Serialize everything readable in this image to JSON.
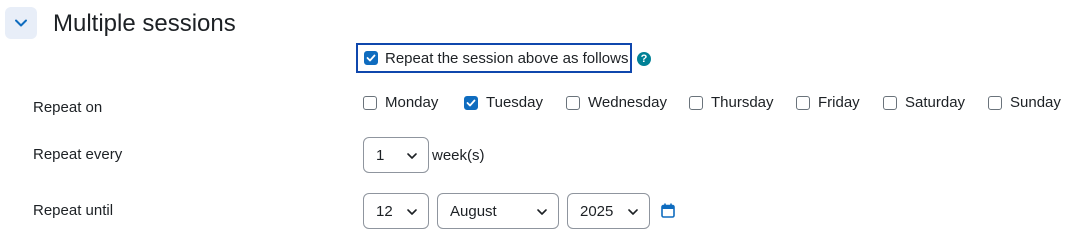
{
  "section": {
    "title": "Multiple sessions"
  },
  "repeat_master": {
    "label": "Repeat the session above as follows",
    "checked": true,
    "help": "?"
  },
  "repeat_on": {
    "label": "Repeat on",
    "days": [
      {
        "name": "Monday",
        "checked": false
      },
      {
        "name": "Tuesday",
        "checked": true
      },
      {
        "name": "Wednesday",
        "checked": false
      },
      {
        "name": "Thursday",
        "checked": false
      },
      {
        "name": "Friday",
        "checked": false
      },
      {
        "name": "Saturday",
        "checked": false
      },
      {
        "name": "Sunday",
        "checked": false
      }
    ]
  },
  "repeat_every": {
    "label": "Repeat every",
    "value": "1",
    "unit": "week(s)"
  },
  "repeat_until": {
    "label": "Repeat until",
    "day": "12",
    "month": "August",
    "year": "2025"
  },
  "colors": {
    "accent": "#0f6cbf",
    "focus_border": "#0f47ad",
    "help": "#008196"
  },
  "icons": {
    "collapse": "chevron-down-icon",
    "calendar": "calendar-icon"
  }
}
